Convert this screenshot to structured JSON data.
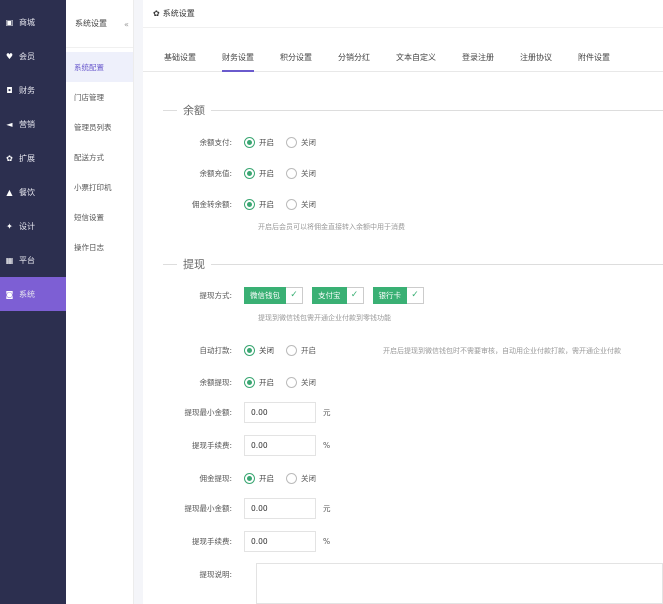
{
  "left_nav": [
    {
      "icon": "shop-icon",
      "glyph": "▣",
      "label": "商城",
      "active": false
    },
    {
      "icon": "member-icon",
      "glyph": "♥",
      "label": "会员",
      "active": false
    },
    {
      "icon": "finance-icon",
      "glyph": "◘",
      "label": "财务",
      "active": false
    },
    {
      "icon": "marketing-icon",
      "glyph": "◄",
      "label": "营销",
      "active": false
    },
    {
      "icon": "extend-icon",
      "glyph": "✿",
      "label": "扩展",
      "active": false
    },
    {
      "icon": "food-icon",
      "glyph": "▲",
      "label": "餐饮",
      "active": false
    },
    {
      "icon": "design-icon",
      "glyph": "✦",
      "label": "设计",
      "active": false
    },
    {
      "icon": "platform-icon",
      "glyph": "▦",
      "label": "平台",
      "active": false
    },
    {
      "icon": "system-icon",
      "glyph": "◙",
      "label": "系统",
      "active": true
    }
  ],
  "sub_nav": {
    "title": "系统设置",
    "collapse_glyph": "«",
    "items": [
      {
        "label": "系统配置",
        "active": true
      },
      {
        "label": "门店管理",
        "active": false
      },
      {
        "label": "管理员列表",
        "active": false
      },
      {
        "label": "配送方式",
        "active": false
      },
      {
        "label": "小票打印机",
        "active": false
      },
      {
        "label": "短信设置",
        "active": false
      },
      {
        "label": "操作日志",
        "active": false
      }
    ]
  },
  "main": {
    "title_glyph": "✿",
    "title": "系统设置",
    "tabs": [
      {
        "label": "基础设置",
        "active": false
      },
      {
        "label": "财务设置",
        "active": true
      },
      {
        "label": "积分设置",
        "active": false
      },
      {
        "label": "分销分红",
        "active": false
      },
      {
        "label": "文本自定义",
        "active": false
      },
      {
        "label": "登录注册",
        "active": false
      },
      {
        "label": "注册协议",
        "active": false
      },
      {
        "label": "附件设置",
        "active": false
      }
    ]
  },
  "balance": {
    "section_title": "余额",
    "pay": {
      "label": "余额支付:",
      "on": "开启",
      "off": "关闭"
    },
    "recharge": {
      "label": "余额充值:",
      "on": "开启",
      "off": "关闭"
    },
    "commission_to_balance": {
      "label": "佣金转余额:",
      "on": "开启",
      "off": "关闭"
    },
    "hint": "开启后会员可以将佣金直接转入余额中用于消费"
  },
  "withdraw": {
    "section_title": "提现",
    "method_label": "提现方式:",
    "methods": [
      "微信钱包",
      "支付宝",
      "银行卡"
    ],
    "check_glyph": "✓",
    "method_hint": "提现到微信钱包需开通企业付款到零钱功能",
    "auto_pay": {
      "label": "自动打款:",
      "off": "关闭",
      "on": "开启",
      "hint": "开启后提现到微信钱包时不需要审核，自动用企业付款打款，需开通企业付款"
    },
    "balance_withdraw": {
      "label": "余额提现:",
      "on": "开启",
      "off": "关闭"
    },
    "min_amount": {
      "label": "提现最小金额:",
      "value": "0.00",
      "unit": "元"
    },
    "fee": {
      "label": "提现手续费:",
      "value": "0.00",
      "unit": "%"
    },
    "commission_withdraw": {
      "label": "佣金提现:",
      "on": "开启",
      "off": "关闭"
    },
    "min_amount2": {
      "label": "提现最小金额:",
      "value": "0.00",
      "unit": "元"
    },
    "fee2": {
      "label": "提现手续费:",
      "value": "0.00",
      "unit": "%"
    },
    "desc": {
      "label": "提现说明:"
    }
  },
  "colors": {
    "accent": "#6a5acd",
    "sidebar": "#2c2f4f",
    "active_nav": "#7d5fd4",
    "green": "#3ab074"
  }
}
